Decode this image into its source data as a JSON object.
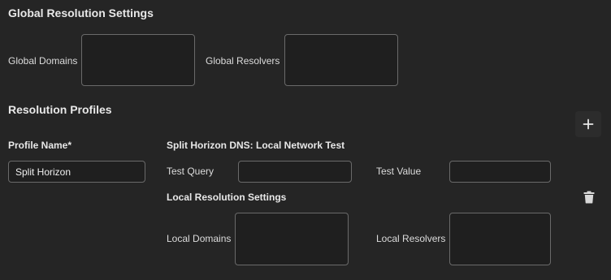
{
  "global": {
    "title": "Global Resolution Settings",
    "domains_label": "Global Domains",
    "domains_value": "",
    "resolvers_label": "Global Resolvers",
    "resolvers_value": ""
  },
  "profiles": {
    "title": "Resolution Profiles",
    "add_icon": "plus-icon",
    "items": [
      {
        "name_label": "Profile Name*",
        "name_value": "Split Horizon",
        "test_title": "Split Horizon DNS: Local Network Test",
        "test_query_label": "Test Query",
        "test_query_value": "",
        "test_value_label": "Test Value",
        "test_value_value": "",
        "local_title": "Local Resolution Settings",
        "local_domains_label": "Local Domains",
        "local_domains_value": "",
        "local_resolvers_label": "Local Resolvers",
        "local_resolvers_value": "",
        "delete_icon": "trash-icon"
      }
    ]
  },
  "colors": {
    "background": "#252525",
    "field_background": "#1f1f1f",
    "field_border": "#6a6a6a",
    "text": "#e4e4e4"
  }
}
